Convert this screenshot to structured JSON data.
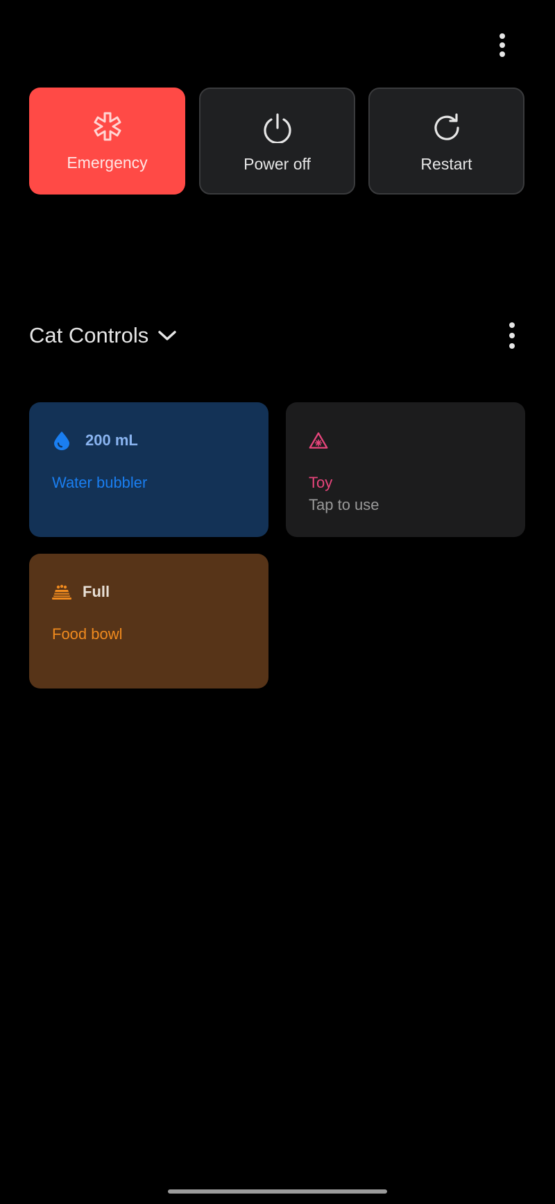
{
  "power_menu": {
    "buttons": [
      {
        "label": "Emergency",
        "icon": "emergency-star-icon"
      },
      {
        "label": "Power off",
        "icon": "power-icon"
      },
      {
        "label": "Restart",
        "icon": "restart-icon"
      }
    ]
  },
  "controls": {
    "title": "Cat Controls",
    "tiles": {
      "water": {
        "status": "200 mL",
        "name": "Water bubbler",
        "icon": "water-drop-icon"
      },
      "toy": {
        "name": "Toy",
        "subtitle": "Tap to use",
        "icon": "laser-warning-icon"
      },
      "food": {
        "status": "Full",
        "name": "Food bowl",
        "icon": "food-bowl-icon"
      }
    }
  },
  "colors": {
    "emergency": "#ff4a46",
    "water_tile": "#133256",
    "water_accent": "#1a7ef0",
    "toy_tile": "#1c1c1d",
    "toy_accent": "#e8457c",
    "food_tile": "#573418",
    "food_accent": "#f08a1e"
  }
}
